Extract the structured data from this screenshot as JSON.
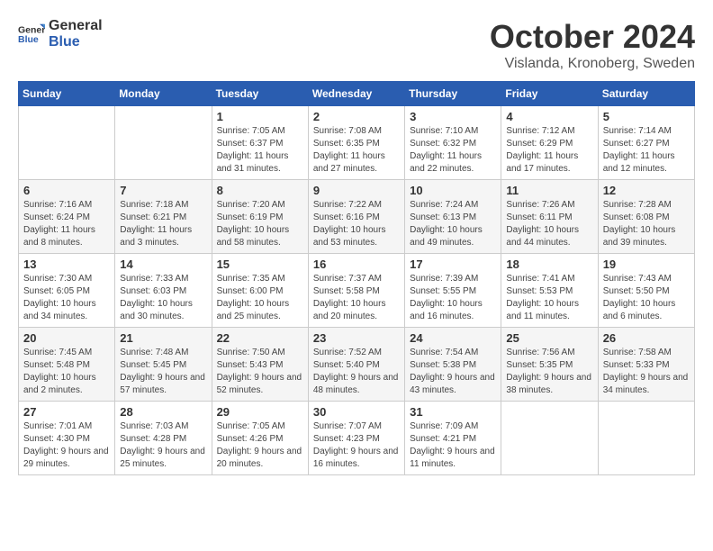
{
  "logo": {
    "general": "General",
    "blue": "Blue"
  },
  "title": "October 2024",
  "location": "Vislanda, Kronoberg, Sweden",
  "headers": [
    "Sunday",
    "Monday",
    "Tuesday",
    "Wednesday",
    "Thursday",
    "Friday",
    "Saturday"
  ],
  "weeks": [
    [
      {
        "day": "",
        "sunrise": "",
        "sunset": "",
        "daylight": ""
      },
      {
        "day": "",
        "sunrise": "",
        "sunset": "",
        "daylight": ""
      },
      {
        "day": "1",
        "sunrise": "Sunrise: 7:05 AM",
        "sunset": "Sunset: 6:37 PM",
        "daylight": "Daylight: 11 hours and 31 minutes."
      },
      {
        "day": "2",
        "sunrise": "Sunrise: 7:08 AM",
        "sunset": "Sunset: 6:35 PM",
        "daylight": "Daylight: 11 hours and 27 minutes."
      },
      {
        "day": "3",
        "sunrise": "Sunrise: 7:10 AM",
        "sunset": "Sunset: 6:32 PM",
        "daylight": "Daylight: 11 hours and 22 minutes."
      },
      {
        "day": "4",
        "sunrise": "Sunrise: 7:12 AM",
        "sunset": "Sunset: 6:29 PM",
        "daylight": "Daylight: 11 hours and 17 minutes."
      },
      {
        "day": "5",
        "sunrise": "Sunrise: 7:14 AM",
        "sunset": "Sunset: 6:27 PM",
        "daylight": "Daylight: 11 hours and 12 minutes."
      }
    ],
    [
      {
        "day": "6",
        "sunrise": "Sunrise: 7:16 AM",
        "sunset": "Sunset: 6:24 PM",
        "daylight": "Daylight: 11 hours and 8 minutes."
      },
      {
        "day": "7",
        "sunrise": "Sunrise: 7:18 AM",
        "sunset": "Sunset: 6:21 PM",
        "daylight": "Daylight: 11 hours and 3 minutes."
      },
      {
        "day": "8",
        "sunrise": "Sunrise: 7:20 AM",
        "sunset": "Sunset: 6:19 PM",
        "daylight": "Daylight: 10 hours and 58 minutes."
      },
      {
        "day": "9",
        "sunrise": "Sunrise: 7:22 AM",
        "sunset": "Sunset: 6:16 PM",
        "daylight": "Daylight: 10 hours and 53 minutes."
      },
      {
        "day": "10",
        "sunrise": "Sunrise: 7:24 AM",
        "sunset": "Sunset: 6:13 PM",
        "daylight": "Daylight: 10 hours and 49 minutes."
      },
      {
        "day": "11",
        "sunrise": "Sunrise: 7:26 AM",
        "sunset": "Sunset: 6:11 PM",
        "daylight": "Daylight: 10 hours and 44 minutes."
      },
      {
        "day": "12",
        "sunrise": "Sunrise: 7:28 AM",
        "sunset": "Sunset: 6:08 PM",
        "daylight": "Daylight: 10 hours and 39 minutes."
      }
    ],
    [
      {
        "day": "13",
        "sunrise": "Sunrise: 7:30 AM",
        "sunset": "Sunset: 6:05 PM",
        "daylight": "Daylight: 10 hours and 34 minutes."
      },
      {
        "day": "14",
        "sunrise": "Sunrise: 7:33 AM",
        "sunset": "Sunset: 6:03 PM",
        "daylight": "Daylight: 10 hours and 30 minutes."
      },
      {
        "day": "15",
        "sunrise": "Sunrise: 7:35 AM",
        "sunset": "Sunset: 6:00 PM",
        "daylight": "Daylight: 10 hours and 25 minutes."
      },
      {
        "day": "16",
        "sunrise": "Sunrise: 7:37 AM",
        "sunset": "Sunset: 5:58 PM",
        "daylight": "Daylight: 10 hours and 20 minutes."
      },
      {
        "day": "17",
        "sunrise": "Sunrise: 7:39 AM",
        "sunset": "Sunset: 5:55 PM",
        "daylight": "Daylight: 10 hours and 16 minutes."
      },
      {
        "day": "18",
        "sunrise": "Sunrise: 7:41 AM",
        "sunset": "Sunset: 5:53 PM",
        "daylight": "Daylight: 10 hours and 11 minutes."
      },
      {
        "day": "19",
        "sunrise": "Sunrise: 7:43 AM",
        "sunset": "Sunset: 5:50 PM",
        "daylight": "Daylight: 10 hours and 6 minutes."
      }
    ],
    [
      {
        "day": "20",
        "sunrise": "Sunrise: 7:45 AM",
        "sunset": "Sunset: 5:48 PM",
        "daylight": "Daylight: 10 hours and 2 minutes."
      },
      {
        "day": "21",
        "sunrise": "Sunrise: 7:48 AM",
        "sunset": "Sunset: 5:45 PM",
        "daylight": "Daylight: 9 hours and 57 minutes."
      },
      {
        "day": "22",
        "sunrise": "Sunrise: 7:50 AM",
        "sunset": "Sunset: 5:43 PM",
        "daylight": "Daylight: 9 hours and 52 minutes."
      },
      {
        "day": "23",
        "sunrise": "Sunrise: 7:52 AM",
        "sunset": "Sunset: 5:40 PM",
        "daylight": "Daylight: 9 hours and 48 minutes."
      },
      {
        "day": "24",
        "sunrise": "Sunrise: 7:54 AM",
        "sunset": "Sunset: 5:38 PM",
        "daylight": "Daylight: 9 hours and 43 minutes."
      },
      {
        "day": "25",
        "sunrise": "Sunrise: 7:56 AM",
        "sunset": "Sunset: 5:35 PM",
        "daylight": "Daylight: 9 hours and 38 minutes."
      },
      {
        "day": "26",
        "sunrise": "Sunrise: 7:58 AM",
        "sunset": "Sunset: 5:33 PM",
        "daylight": "Daylight: 9 hours and 34 minutes."
      }
    ],
    [
      {
        "day": "27",
        "sunrise": "Sunrise: 7:01 AM",
        "sunset": "Sunset: 4:30 PM",
        "daylight": "Daylight: 9 hours and 29 minutes."
      },
      {
        "day": "28",
        "sunrise": "Sunrise: 7:03 AM",
        "sunset": "Sunset: 4:28 PM",
        "daylight": "Daylight: 9 hours and 25 minutes."
      },
      {
        "day": "29",
        "sunrise": "Sunrise: 7:05 AM",
        "sunset": "Sunset: 4:26 PM",
        "daylight": "Daylight: 9 hours and 20 minutes."
      },
      {
        "day": "30",
        "sunrise": "Sunrise: 7:07 AM",
        "sunset": "Sunset: 4:23 PM",
        "daylight": "Daylight: 9 hours and 16 minutes."
      },
      {
        "day": "31",
        "sunrise": "Sunrise: 7:09 AM",
        "sunset": "Sunset: 4:21 PM",
        "daylight": "Daylight: 9 hours and 11 minutes."
      },
      {
        "day": "",
        "sunrise": "",
        "sunset": "",
        "daylight": ""
      },
      {
        "day": "",
        "sunrise": "",
        "sunset": "",
        "daylight": ""
      }
    ]
  ]
}
